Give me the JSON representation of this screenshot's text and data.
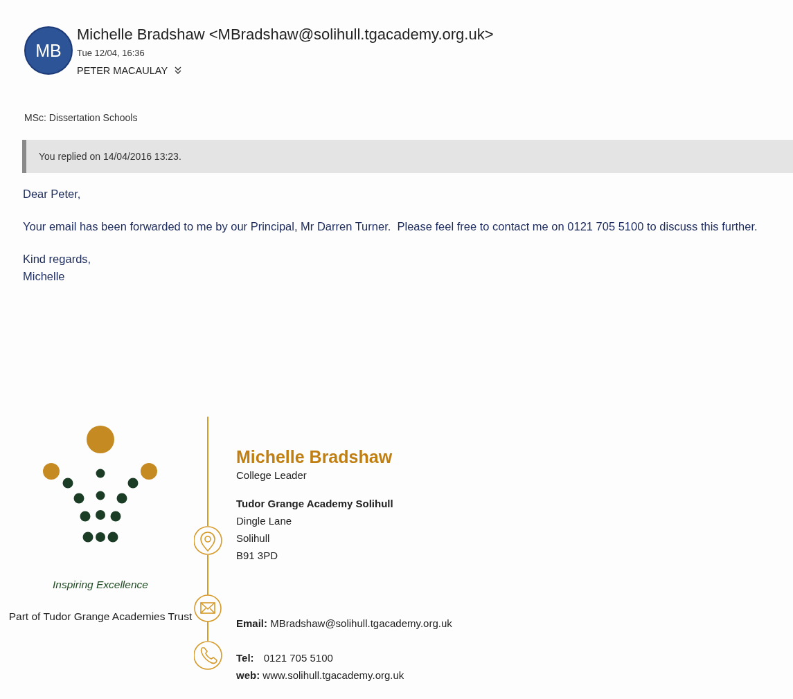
{
  "sender": {
    "initials": "MB",
    "name_line": "Michelle Bradshaw <MBradshaw@solihull.tgacademy.org.uk>",
    "date": "Tue 12/04, 16:36",
    "recipient": "PETER MACAULAY"
  },
  "subject": "MSc: Dissertation Schools",
  "reply_notice": "You replied on 14/04/2016 13:23.",
  "body": {
    "greeting": "Dear Peter,",
    "paragraphs": [
      "Your email has been forwarded to me by our Principal, Mr Darren Turner.  Please feel free to contact me on 0121 705 5100 to discuss this further."
    ],
    "closing": [
      "Kind regards,",
      "Michelle"
    ]
  },
  "signature": {
    "tagline": "Inspiring Excellence",
    "trust": "Part of Tudor Grange Academies Trust",
    "name": "Michelle Bradshaw",
    "role": "College Leader",
    "organisation": "Tudor Grange Academy Solihull",
    "address": [
      "Dingle Lane",
      "Solihull",
      "B91 3PD"
    ],
    "email_label": "Email:",
    "email": "MBradshaw@solihull.tgacademy.org.uk",
    "tel_label": "Tel:",
    "tel": "0121 705 5100",
    "web_label": "web:",
    "web": "www.solihull.tgacademy.org.uk"
  }
}
